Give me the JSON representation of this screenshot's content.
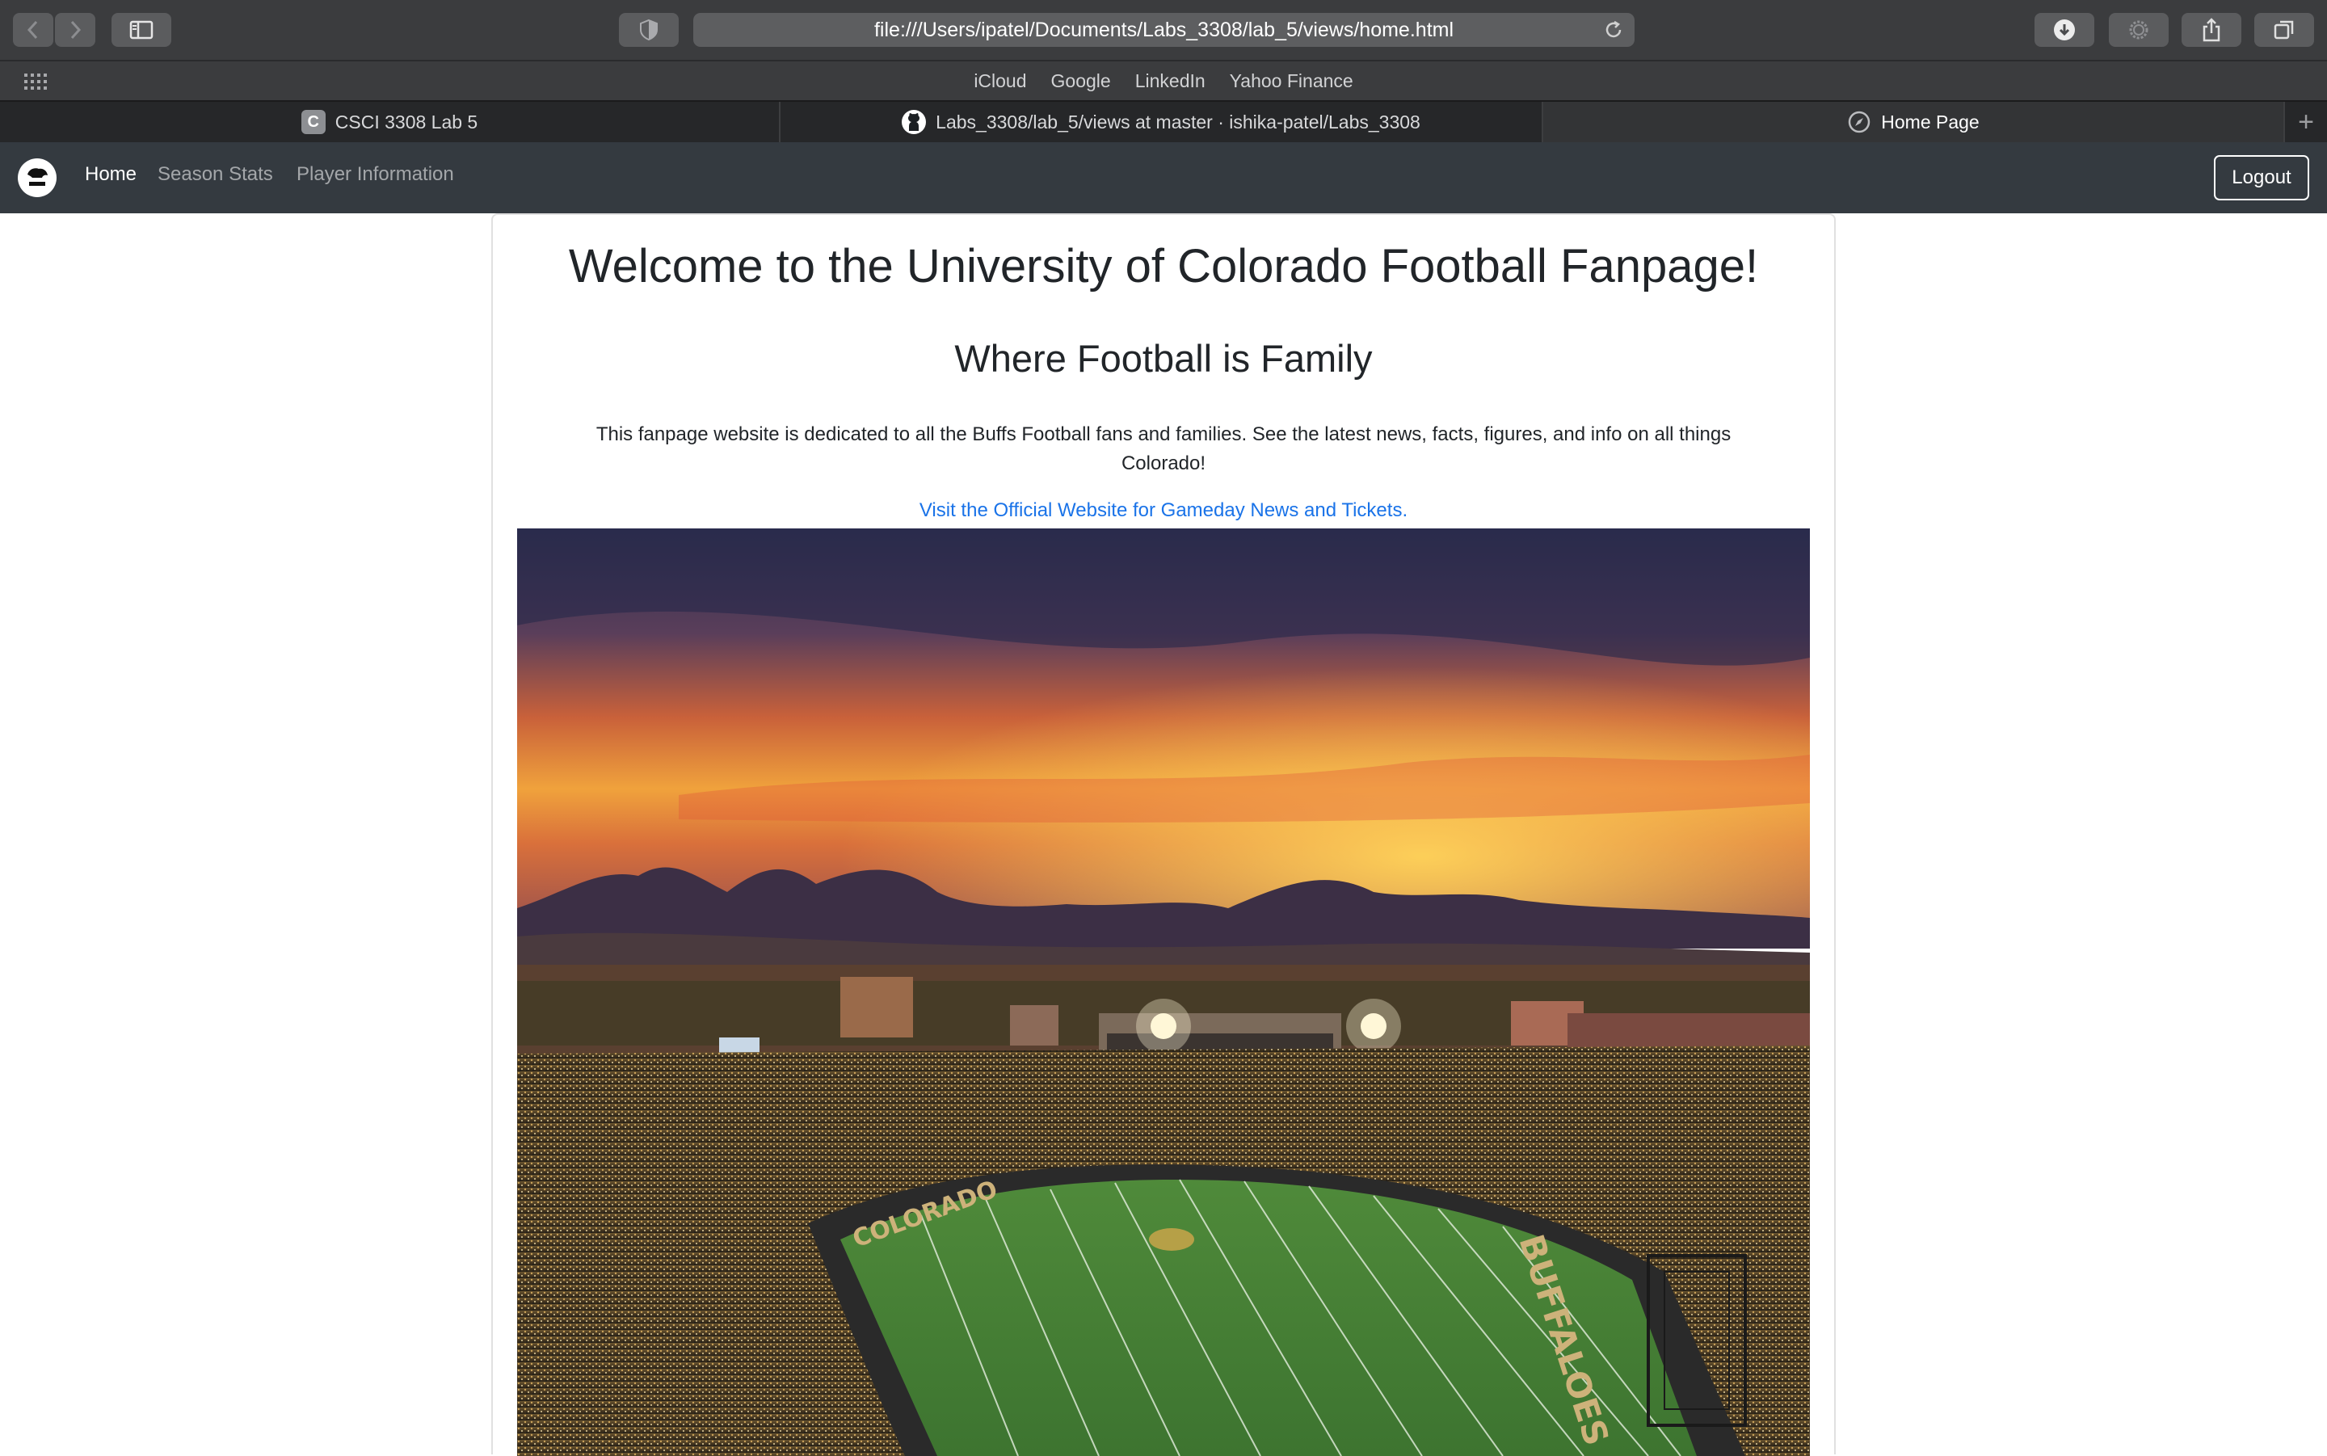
{
  "browser": {
    "url": "file:///Users/ipatel/Documents/Labs_3308/lab_5/views/home.html",
    "favorites": [
      "iCloud",
      "Google",
      "LinkedIn",
      "Yahoo Finance"
    ],
    "tabs": [
      {
        "label": "CSCI 3308 Lab 5",
        "icon": "letter-c-icon",
        "active": false
      },
      {
        "label": "Labs_3308/lab_5/views at master · ishika-patel/Labs_3308",
        "icon": "github-icon",
        "active": false
      },
      {
        "label": "Home Page",
        "icon": "compass-icon",
        "active": true
      }
    ],
    "new_tab_label": "+",
    "fav_letter": "C"
  },
  "navbar": {
    "logo": "cu-buffaloes-logo",
    "links": [
      "Home",
      "Season Stats",
      "Player Information"
    ],
    "active_link": "Home",
    "logout_label": "Logout"
  },
  "main": {
    "title": "Welcome to the University of Colorado Football Fanpage!",
    "subtitle": "Where Football is Family",
    "intro": "This fanpage website is dedicated to all the Buffs Football fans and families. See the latest news, facts, figures, and info on all things Colorado!",
    "link_text": "Visit the Official Website for Gameday News and Tickets.",
    "image": {
      "description": "stadium-at-sunset-photo",
      "endzone_text": "COLORADO",
      "sideline_text": "BUFFALOES"
    }
  },
  "colors": {
    "chrome": "#3b3c3e",
    "navbar": "#343a40",
    "link": "#1a73e8",
    "text": "#212529"
  }
}
